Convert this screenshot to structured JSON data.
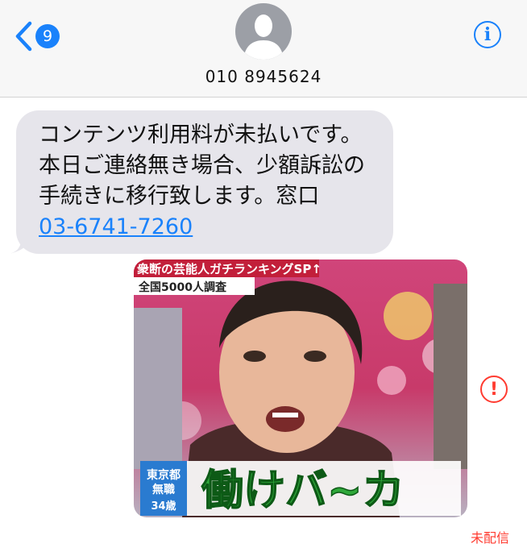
{
  "header": {
    "back_badge_count": "9",
    "contact_number": "010 8945624",
    "info_label": "i",
    "accent_color": "#1a82fb"
  },
  "message": {
    "text_line1": "コンテンツ利用料が未払いです。",
    "text_line2": "本日ご連絡無き場合、少額訴訟の",
    "text_line3": "手続きに移行致します。窓口",
    "link_text": "03-6741-7260"
  },
  "image": {
    "banner_top": "衆断の芸能人ガチランキングSP↑",
    "banner_sub": "全国5000人調査",
    "caption_main": "働けバ~カ",
    "caption_side_line1": "東京都",
    "caption_side_line2": "無職",
    "caption_side_line3": "34歳"
  },
  "status": {
    "alert_symbol": "!",
    "undelivered_label": "未配信",
    "alert_color": "#ff3b30"
  }
}
